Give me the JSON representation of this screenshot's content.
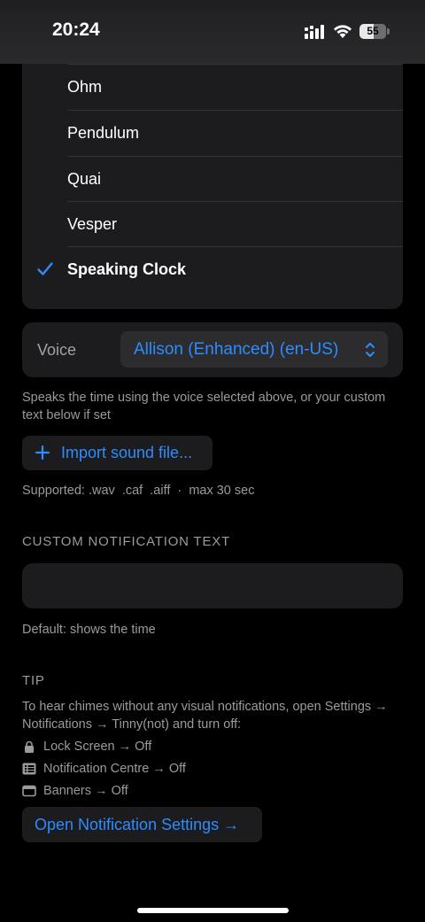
{
  "status_bar": {
    "time": "20:24",
    "battery": "55"
  },
  "sound_list": {
    "items": [
      {
        "label": ""
      },
      {
        "label": "Ohm"
      },
      {
        "label": "Pendulum"
      },
      {
        "label": "Quai"
      },
      {
        "label": "Vesper"
      },
      {
        "label": "Speaking Clock",
        "selected": true
      }
    ]
  },
  "voice": {
    "label": "Voice",
    "selected": "Allison (Enhanced) (en-US)",
    "description": "Speaks the time using the voice selected above, or your custom text below if set"
  },
  "import": {
    "button_label": "Import sound file...",
    "supported": "Supported: .wav  .caf  .aiff  ·  max 30 sec"
  },
  "custom_text": {
    "header": "CUSTOM NOTIFICATION TEXT",
    "value": "",
    "hint": "Default: shows the time"
  },
  "tip": {
    "header": "TIP",
    "body": "To hear chimes without any visual notifications, open Settings → Notifications → Tinny(not) and turn off:",
    "items": [
      {
        "icon": "lock-icon",
        "label": "Lock Screen → Off"
      },
      {
        "icon": "notification-centre-icon",
        "label": "Notification Centre → Off"
      },
      {
        "icon": "banner-icon",
        "label": "Banners → Off"
      }
    ],
    "button_label": "Open Notification Settings →"
  },
  "colors": {
    "accent": "#2d8cff",
    "card": "#1c1c1e",
    "background": "#000000",
    "secondary_text": "#9a9a9f"
  }
}
